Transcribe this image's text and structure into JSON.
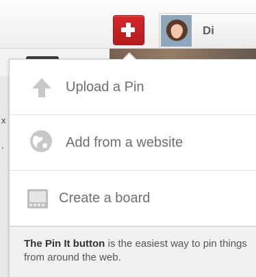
{
  "header": {
    "user_name": "Di"
  },
  "menu": {
    "items": [
      {
        "label": "Upload a Pin",
        "icon": "upload-arrow-icon"
      },
      {
        "label": "Add from a website",
        "icon": "globe-icon"
      },
      {
        "label": "Create a board",
        "icon": "board-icon"
      }
    ],
    "footer": {
      "strong": "The Pin It button",
      "text": " is the easiest way to pin things from around the web."
    }
  },
  "colors": {
    "accent_red": "#c62025",
    "menu_text": "#6f6f6f",
    "icon_gray": "#c7c7c7"
  }
}
